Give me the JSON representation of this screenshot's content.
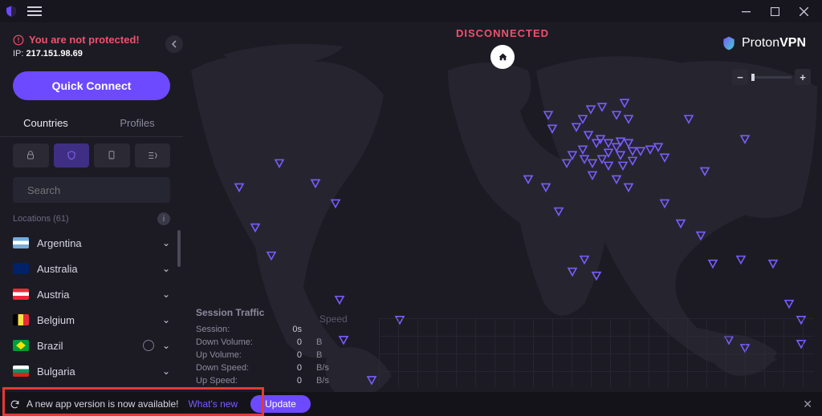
{
  "status": {
    "disconnected_label": "DISCONNECTED",
    "not_protected": "You are not protected!",
    "ip_label": "IP:",
    "ip_value": "217.151.98.69"
  },
  "sidebar": {
    "quick_connect": "Quick Connect",
    "tabs": {
      "countries": "Countries",
      "profiles": "Profiles"
    },
    "search_placeholder": "Search",
    "locations_header": "Locations (61)",
    "countries": [
      {
        "name": "Argentina",
        "flag": "ar"
      },
      {
        "name": "Australia",
        "flag": "au"
      },
      {
        "name": "Austria",
        "flag": "at"
      },
      {
        "name": "Belgium",
        "flag": "be"
      },
      {
        "name": "Brazil",
        "flag": "br",
        "p2p": true
      },
      {
        "name": "Bulgaria",
        "flag": "bg"
      }
    ]
  },
  "brand": {
    "name1": "Proton",
    "name2": "VPN"
  },
  "zoom": {
    "minus": "−",
    "plus": "+"
  },
  "session": {
    "title": "Session Traffic",
    "speed_title": "Speed",
    "rows": [
      {
        "label": "Session:",
        "value": "0s",
        "unit": ""
      },
      {
        "label": "Down Volume:",
        "value": "0",
        "unit": "B"
      },
      {
        "label": "Up Volume:",
        "value": "0",
        "unit": "B"
      },
      {
        "label": "Down Speed:",
        "value": "0",
        "unit": "B/s"
      },
      {
        "label": "Up Speed:",
        "value": "0",
        "unit": "B/s"
      }
    ]
  },
  "update": {
    "message": "A new app version is now available!",
    "whats_new": "What's new",
    "button": "Update"
  }
}
